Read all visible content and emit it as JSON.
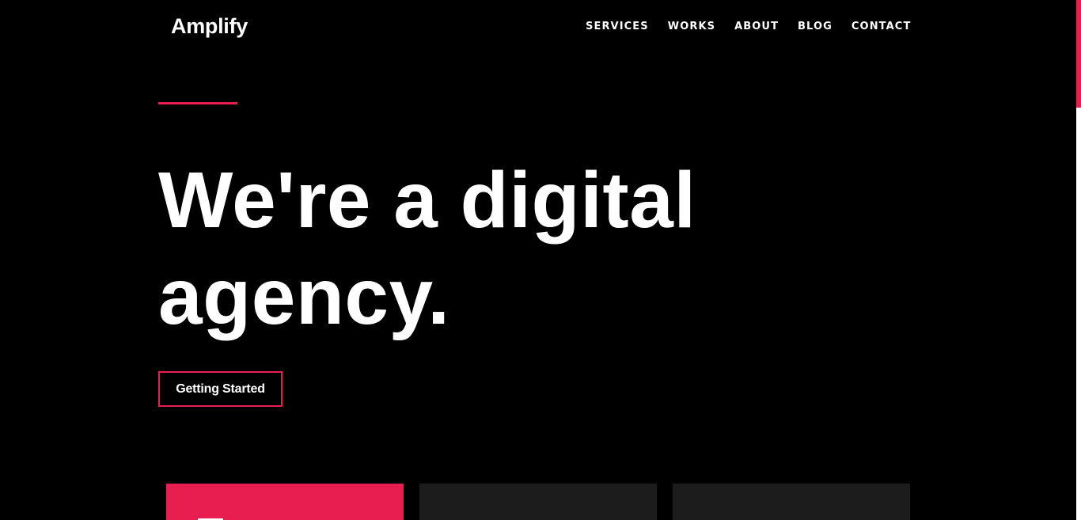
{
  "header": {
    "brand": "Amplify",
    "nav": [
      {
        "label": "SERVICES"
      },
      {
        "label": "WORKS"
      },
      {
        "label": "ABOUT"
      },
      {
        "label": "BLOG"
      },
      {
        "label": "CONTACT"
      }
    ]
  },
  "hero": {
    "title_line1": "We're a digital",
    "title_line2": "agency.",
    "cta_label": "Getting Started"
  },
  "theme": {
    "background": "#000000",
    "accent": "#e91e50",
    "card_dark": "#1c1c1c",
    "text": "#ffffff"
  }
}
